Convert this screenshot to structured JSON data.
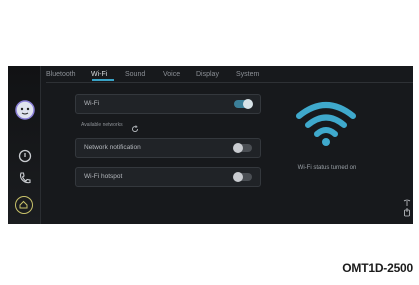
{
  "tabs": [
    {
      "label": "Bluetooth",
      "active": false
    },
    {
      "label": "Wi-Fi",
      "active": true
    },
    {
      "label": "Sound",
      "active": false
    },
    {
      "label": "Voice",
      "active": false
    },
    {
      "label": "Display",
      "active": false
    },
    {
      "label": "System",
      "active": false
    }
  ],
  "wifi": {
    "label": "Wi-Fi",
    "toggle": "on"
  },
  "available_networks": {
    "label": "Available networks",
    "icon": "refresh-icon"
  },
  "network_notification": {
    "label": "Network notification",
    "toggle": "off"
  },
  "wifi_hotspot": {
    "label": "Wi-Fi hotspot",
    "toggle": "off"
  },
  "status": {
    "text": "Wi-Fi status turned on",
    "icon": "wifi-icon"
  },
  "sidebar": {
    "icons": [
      "assistant-icon",
      "power-icon",
      "phone-icon",
      "home-icon"
    ]
  },
  "right_icons": [
    "signal-icon",
    "touch-icon"
  ],
  "figure_code": "OMT1D-2500",
  "colors": {
    "accent": "#39a3c6",
    "screen_bg": "#17191c",
    "home_ring": "#c9c36b"
  }
}
